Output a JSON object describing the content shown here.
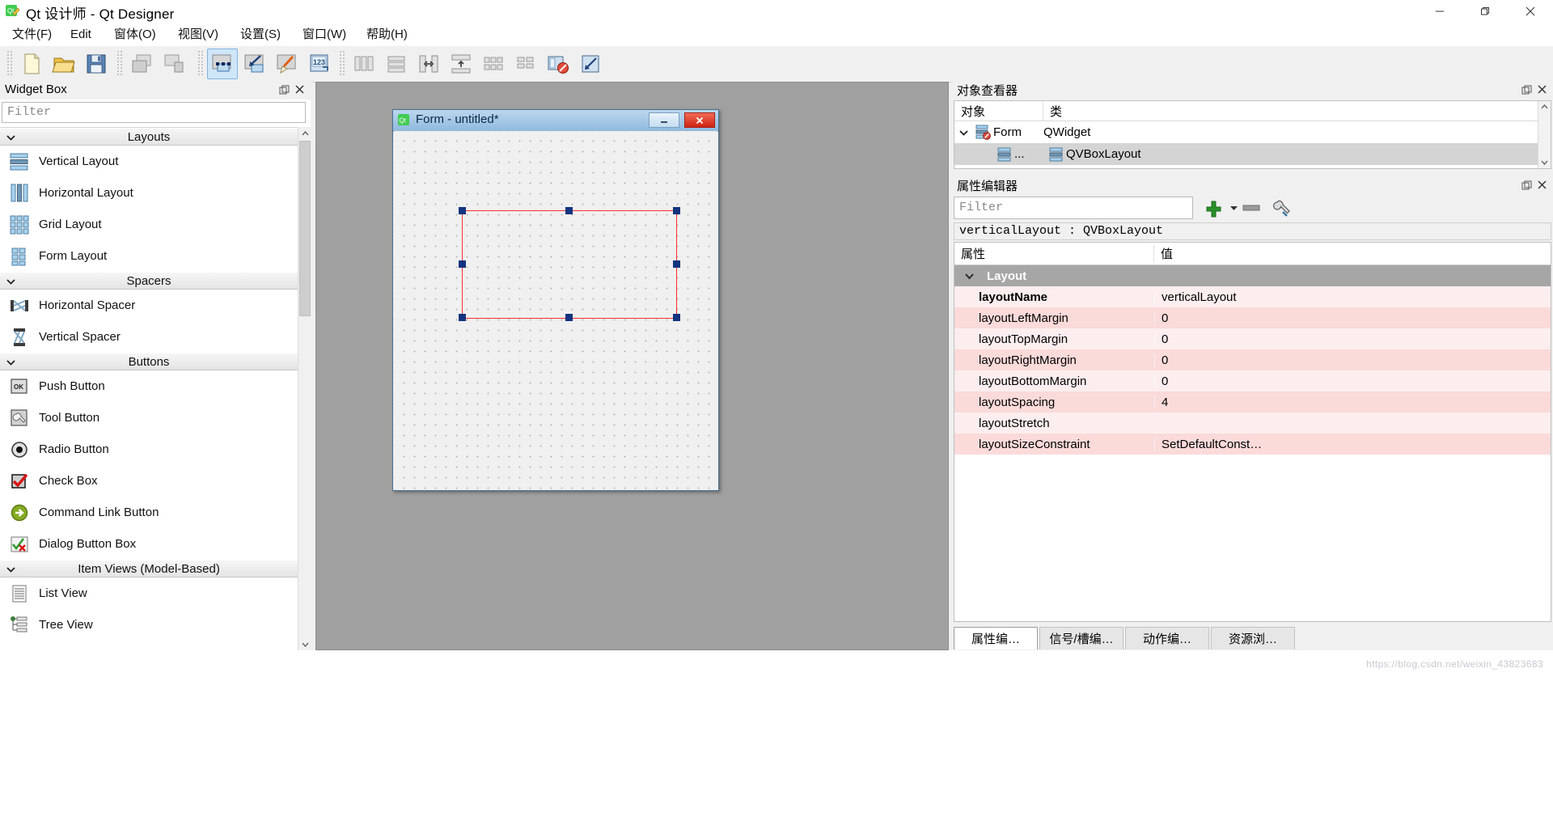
{
  "window": {
    "title": "Qt 设计师 - Qt Designer",
    "app_icon": "qt-designer-icon",
    "minimize_label": "minimize-icon",
    "maximize_label": "restore-icon",
    "close_label": "close-icon"
  },
  "menubar": {
    "items": [
      {
        "label": "文件(F)",
        "name": "menu-file"
      },
      {
        "label": "Edit",
        "name": "menu-edit"
      },
      {
        "label": "窗体(O)",
        "name": "menu-form"
      },
      {
        "label": "视图(V)",
        "name": "menu-view"
      },
      {
        "label": "设置(S)",
        "name": "menu-settings"
      },
      {
        "label": "窗口(W)",
        "name": "menu-window"
      },
      {
        "label": "帮助(H)",
        "name": "menu-help"
      }
    ]
  },
  "toolbar": {
    "groups": [
      {
        "name": "file-group",
        "buttons": [
          {
            "name": "new-form-button",
            "icon": "new-document-icon",
            "active": false
          },
          {
            "name": "open-form-button",
            "icon": "open-folder-icon",
            "active": false
          },
          {
            "name": "save-form-button",
            "icon": "floppy-save-icon",
            "active": false
          }
        ]
      },
      {
        "name": "undo-group",
        "buttons": [
          {
            "name": "undo-button",
            "icon": "undo-stack-icon",
            "active": false
          },
          {
            "name": "redo-button",
            "icon": "redo-stack-icon",
            "active": false
          }
        ]
      },
      {
        "name": "mode-group",
        "buttons": [
          {
            "name": "edit-widgets-button",
            "icon": "edit-widgets-icon",
            "active": true
          },
          {
            "name": "edit-signals-slots-button",
            "icon": "signals-slots-icon",
            "active": false
          },
          {
            "name": "edit-buddies-button",
            "icon": "buddy-edit-icon",
            "active": false
          },
          {
            "name": "edit-tab-order-button",
            "icon": "tab-order-123-icon",
            "active": false
          }
        ]
      },
      {
        "name": "layout-group",
        "buttons": [
          {
            "name": "layout-horizontally-button",
            "icon": "layout-horizontal-icon",
            "active": false
          },
          {
            "name": "layout-vertically-button",
            "icon": "layout-vertical-icon",
            "active": false
          },
          {
            "name": "layout-splitter-horizontal-button",
            "icon": "splitter-horizontal-icon",
            "active": false
          },
          {
            "name": "layout-splitter-vertical-button",
            "icon": "splitter-vertical-icon",
            "active": false
          },
          {
            "name": "layout-grid-button",
            "icon": "layout-grid-icon",
            "active": false
          },
          {
            "name": "layout-form-button",
            "icon": "layout-form-icon",
            "active": false
          },
          {
            "name": "break-layout-button",
            "icon": "break-layout-icon",
            "active": false
          },
          {
            "name": "adjust-size-button",
            "icon": "adjust-size-icon",
            "active": false
          }
        ]
      }
    ]
  },
  "widget_box": {
    "title": "Widget Box",
    "float_icon": "undock-icon",
    "close_icon": "close-icon",
    "filter_placeholder": "Filter",
    "sections": [
      {
        "name": "layouts",
        "label": "Layouts",
        "expanded": true,
        "items": [
          {
            "label": "Vertical Layout",
            "icon": "vertical-layout-icon"
          },
          {
            "label": "Horizontal Layout",
            "icon": "horizontal-layout-icon"
          },
          {
            "label": "Grid Layout",
            "icon": "grid-layout-icon"
          },
          {
            "label": "Form Layout",
            "icon": "form-layout-icon"
          }
        ]
      },
      {
        "name": "spacers",
        "label": "Spacers",
        "expanded": true,
        "items": [
          {
            "label": "Horizontal Spacer",
            "icon": "horizontal-spacer-icon"
          },
          {
            "label": "Vertical Spacer",
            "icon": "vertical-spacer-icon"
          }
        ]
      },
      {
        "name": "buttons",
        "label": "Buttons",
        "expanded": true,
        "items": [
          {
            "label": "Push Button",
            "icon": "push-button-icon"
          },
          {
            "label": "Tool Button",
            "icon": "tool-button-icon"
          },
          {
            "label": "Radio Button",
            "icon": "radio-button-icon"
          },
          {
            "label": "Check Box",
            "icon": "check-box-icon"
          },
          {
            "label": "Command Link Button",
            "icon": "command-link-icon"
          },
          {
            "label": "Dialog Button Box",
            "icon": "dialog-button-box-icon"
          }
        ]
      },
      {
        "name": "item-views",
        "label": "Item Views (Model-Based)",
        "expanded": true,
        "items": [
          {
            "label": "List View",
            "icon": "list-view-icon"
          },
          {
            "label": "Tree View",
            "icon": "tree-view-icon"
          }
        ]
      }
    ]
  },
  "form_window": {
    "title": "Form - untitled*",
    "icon": "qt-form-icon",
    "minimize_label": "minimize-icon",
    "close_label": "close-icon",
    "selection": {
      "name": "selected-widget",
      "handles": 8
    }
  },
  "object_inspector": {
    "title": "对象查看器",
    "float_icon": "undock-icon",
    "close_icon": "close-icon",
    "columns": [
      "对象",
      "类"
    ],
    "rows": [
      {
        "name": "Form",
        "class": "QWidget",
        "icon": "form-widget-icon",
        "expanded": true,
        "selected": false,
        "depth": 0
      },
      {
        "name": "...",
        "class": "QVBoxLayout",
        "icon": "vbox-layout-icon",
        "expanded": false,
        "selected": true,
        "depth": 1
      }
    ]
  },
  "property_editor": {
    "title": "属性编辑器",
    "float_icon": "undock-icon",
    "close_icon": "close-icon",
    "filter_placeholder": "Filter",
    "add_icon": "plus-icon",
    "remove_icon": "minus-icon",
    "configure_icon": "wrench-icon",
    "object_line": "verticalLayout : QVBoxLayout",
    "columns": [
      "属性",
      "值"
    ],
    "group": {
      "label": "Layout",
      "expanded": true
    },
    "rows": [
      {
        "key": "layoutName",
        "value": "verticalLayout",
        "bold": true
      },
      {
        "key": "layoutLeftMargin",
        "value": "0",
        "bold": false
      },
      {
        "key": "layoutTopMargin",
        "value": "0",
        "bold": false
      },
      {
        "key": "layoutRightMargin",
        "value": "0",
        "bold": false
      },
      {
        "key": "layoutBottomMargin",
        "value": "0",
        "bold": false
      },
      {
        "key": "layoutSpacing",
        "value": "4",
        "bold": false
      },
      {
        "key": "layoutStretch",
        "value": "",
        "bold": false
      },
      {
        "key": "layoutSizeConstraint",
        "value": "SetDefaultConst…",
        "bold": false
      }
    ],
    "tabs": [
      {
        "label": "属性编…",
        "active": true,
        "name": "tab-property-editor"
      },
      {
        "label": "信号/槽编…",
        "active": false,
        "name": "tab-signal-slot-editor"
      },
      {
        "label": "动作编…",
        "active": false,
        "name": "tab-action-editor"
      },
      {
        "label": "资源浏…",
        "active": false,
        "name": "tab-resource-browser"
      }
    ]
  },
  "watermark": "https://blog.csdn.net/weixin_43823683",
  "colors": {
    "accent": "#cfe6f9",
    "selection_red": "#ff2d2d",
    "handle_blue": "#12347f",
    "property_row_odd": "#fbdada",
    "property_row_even": "#fceeee",
    "group_header": "#a6a6a6",
    "canvas": "#a0a0a0"
  }
}
